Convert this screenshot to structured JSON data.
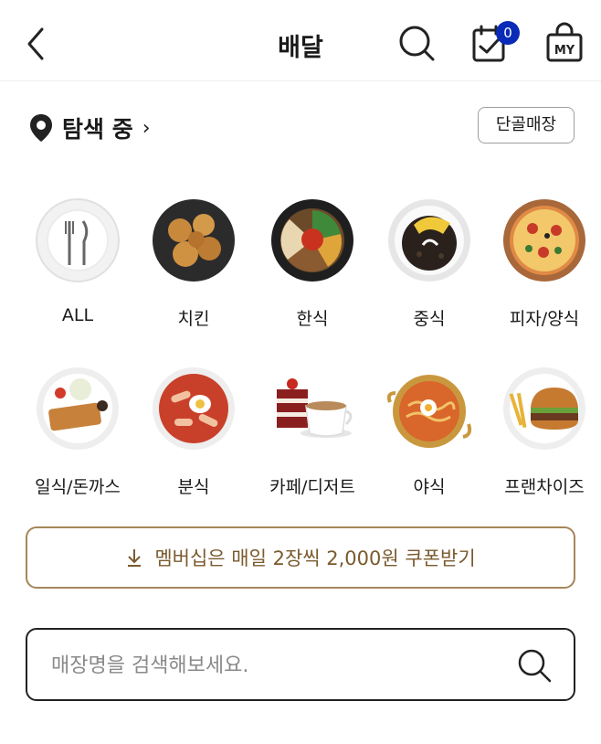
{
  "header": {
    "title": "배달",
    "cart_count": "0"
  },
  "location": {
    "label": "탐색 중",
    "regular_button": "단골매장"
  },
  "categories": [
    {
      "label": "ALL",
      "icon": "fork-knife-plate-icon"
    },
    {
      "label": "치킨",
      "icon": "chicken-icon"
    },
    {
      "label": "한식",
      "icon": "bibimbap-icon"
    },
    {
      "label": "중식",
      "icon": "jjajangmyeon-icon"
    },
    {
      "label": "피자/양식",
      "icon": "pizza-icon"
    },
    {
      "label": "일식/돈까스",
      "icon": "tonkatsu-icon"
    },
    {
      "label": "분식",
      "icon": "tteokbokki-icon"
    },
    {
      "label": "카페/디저트",
      "icon": "cake-coffee-icon"
    },
    {
      "label": "야식",
      "icon": "ramen-icon"
    },
    {
      "label": "프랜차이즈",
      "icon": "burger-icon"
    }
  ],
  "banner": {
    "text": "멤버십은 매일 2장씩 2,000원 쿠폰받기"
  },
  "search": {
    "placeholder": "매장명을 검색해보세요."
  },
  "colors": {
    "badge": "#0a2bb8",
    "banner_border": "#a6865a",
    "banner_text": "#7a5a2e"
  }
}
